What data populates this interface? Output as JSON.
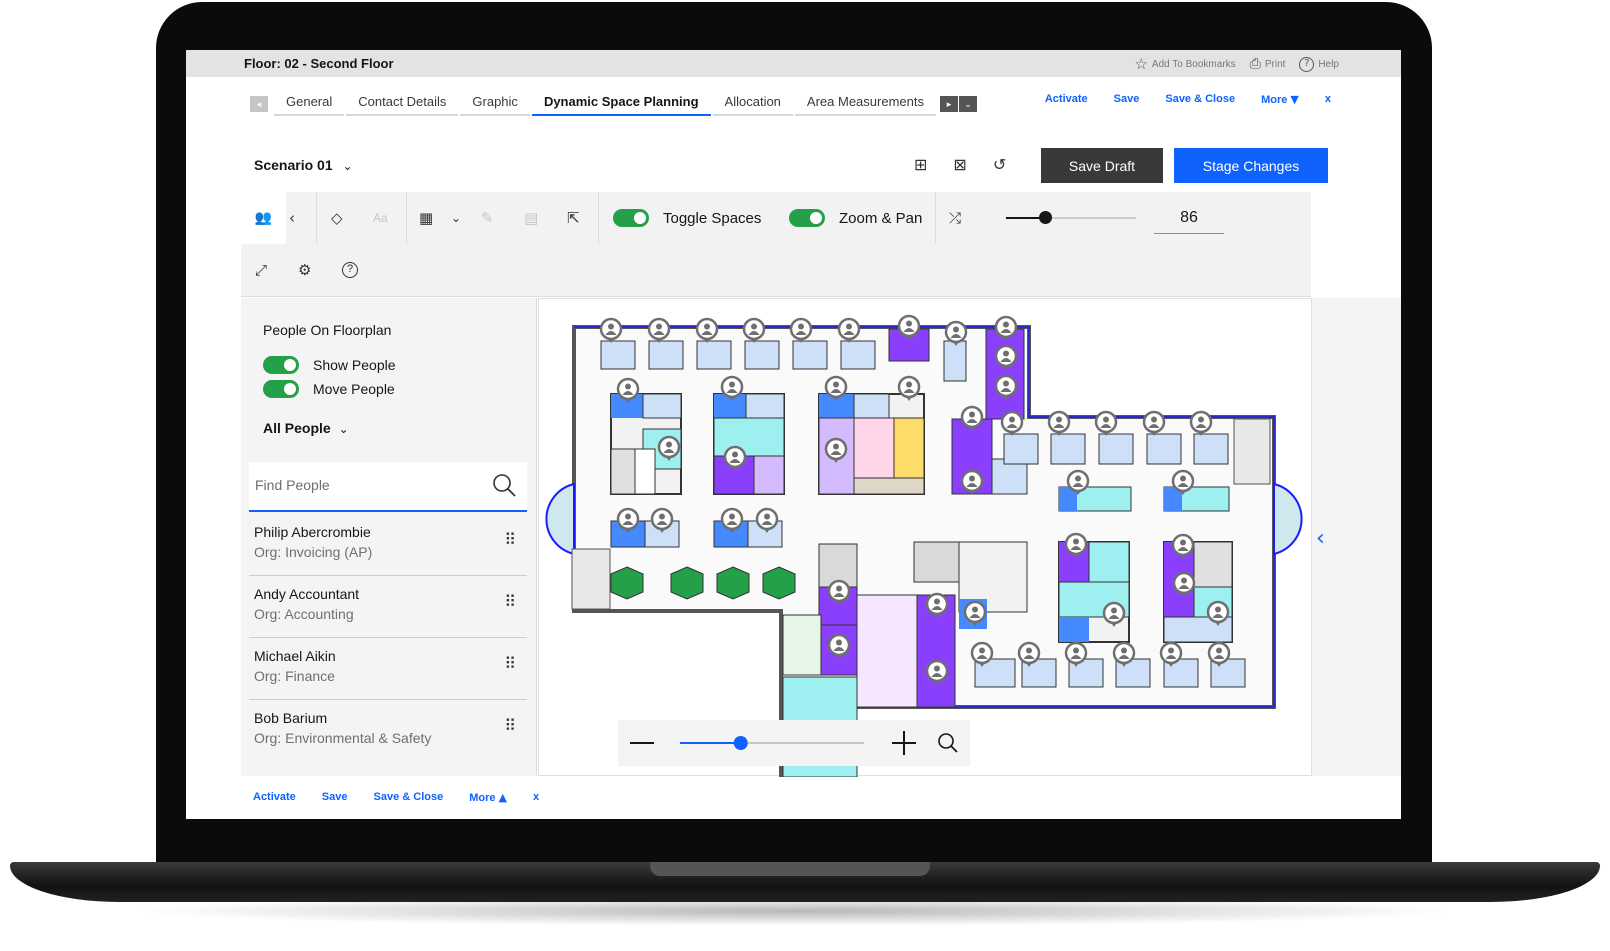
{
  "header": {
    "floor_title": "Floor: 02 - Second Floor",
    "bookmarks": "Add To Bookmarks",
    "print": "Print",
    "help": "Help"
  },
  "tabs": [
    "General",
    "Contact Details",
    "Graphic",
    "Dynamic Space Planning",
    "Allocation",
    "Area Measurements"
  ],
  "active_tab": "Dynamic Space Planning",
  "top_links": [
    "Activate",
    "Save",
    "Save & Close",
    "More",
    "x"
  ],
  "scenario": "Scenario 01",
  "buttons": {
    "save_draft": "Save Draft",
    "stage_changes": "Stage Changes"
  },
  "toolbar": {
    "toggle_spaces": "Toggle Spaces",
    "zoom_pan": "Zoom & Pan",
    "zoom_value": "86",
    "zoom_slider_fraction": 0.3
  },
  "panel": {
    "title": "People On Floorplan",
    "show_people": "Show People",
    "move_people": "Move People",
    "filter": "All People",
    "search_placeholder": "Find People"
  },
  "people": [
    {
      "name": "Philip Abercrombie",
      "org": "Org: Invoicing (AP)"
    },
    {
      "name": "Andy Accountant",
      "org": "Org: Accounting"
    },
    {
      "name": "Michael Aikin",
      "org": "Org: Finance"
    },
    {
      "name": "Bob Barium",
      "org": "Org: Environmental & Safety"
    }
  ],
  "map_zoom_fraction": 0.33,
  "bottom_links": [
    "Activate",
    "Save",
    "Save & Close",
    "More",
    "x"
  ],
  "colors": {
    "accent": "#0f62fe",
    "toggle_on": "#24a148",
    "dark_button": "#393939",
    "room_purple": "#8a3ffc",
    "room_blue": "#4589ff",
    "room_teal": "#9ef0f0",
    "desk_green": "#24a148"
  }
}
